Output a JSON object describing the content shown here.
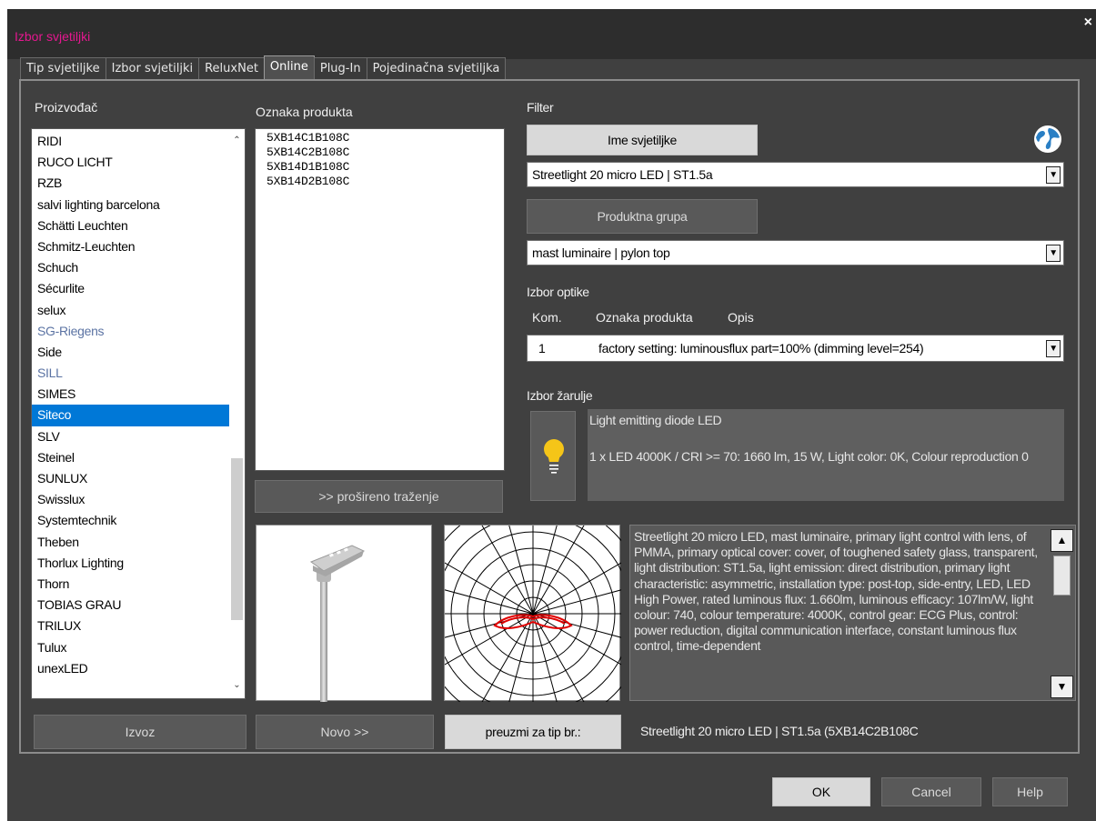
{
  "window": {
    "title": "Izbor svjetiljki",
    "close_label": "×"
  },
  "tabs": [
    {
      "label": "Tip svjetiljke"
    },
    {
      "label": "Izbor svjetiljki"
    },
    {
      "label": "ReluxNet"
    },
    {
      "label": "Online"
    },
    {
      "label": "Plug-In"
    },
    {
      "label": "Pojedinačna svjetiljka"
    }
  ],
  "labels": {
    "manufacturer": "Proizvođač",
    "product_code": "Oznaka produkta",
    "filter": "Filter",
    "optics": "Izbor optike",
    "col_kom": "Kom.",
    "col_code": "Oznaka produkta",
    "col_desc": "Opis",
    "lamp": "Izbor žarulje"
  },
  "manufacturers": [
    "RIDI",
    "RUCO LICHT",
    "RZB",
    "salvi lighting barcelona",
    "Schätti Leuchten",
    "Schmitz-Leuchten",
    "Schuch",
    "Sécurlite",
    "selux",
    "SG-Riegens",
    "Side",
    "SILL",
    "SIMES",
    "Siteco",
    "SLV",
    "Steinel",
    "SUNLUX",
    "Swisslux",
    "Systemtechnik",
    "Theben",
    "Thorlux Lighting",
    "Thorn",
    "TOBIAS GRAU",
    "TRILUX",
    "Tulux",
    "unexLED"
  ],
  "products": [
    "5XB14C1B108C",
    "5XB14C2B108C",
    "5XB14D1B108C",
    "5XB14D2B108C"
  ],
  "filter": {
    "name_button": "Ime svjetiljke",
    "name_value": "Streetlight 20 micro LED | ST1.5a",
    "group_button": "Produktna grupa",
    "group_value": "mast luminaire | pylon top"
  },
  "optics": {
    "kom": "1",
    "value": "factory setting: luminousflux part=100% (dimming level=254)"
  },
  "lamp": {
    "line1": "Light emitting diode LED",
    "line2": "1 x LED 4000K / CRI >= 70: 1660 lm, 15 W, Light color: 0K, Colour reproduction 0"
  },
  "description": "Streetlight 20 micro LED, mast luminaire, primary light control with lens, of PMMA, primary optical cover: cover, of toughened safety glass, transparent, light distribution: ST1.5a, light emission: direct distribution, primary light characteristic: asymmetric, installation type: post-top, side-entry, LED, LED High Power, rated luminous flux: 1.660lm, luminous efficacy: 107lm/W, light colour: 740, colour temperature: 4000K, control gear: ECG Plus, control: power reduction, digital communication interface, constant luminous flux control, time-dependent",
  "buttons": {
    "extended_search": ">> prošireno traženje",
    "export": "Izvoz",
    "new": "Novo >>",
    "take_for_type": "preuzmi za tip br.:",
    "ok": "OK",
    "cancel": "Cancel",
    "help": "Help"
  },
  "status": "Streetlight 20 micro LED | ST1.5a (5XB14C2B108C",
  "colors": {
    "title": "#e5178f",
    "selection": "#0078d7",
    "curve": "#e00000"
  }
}
